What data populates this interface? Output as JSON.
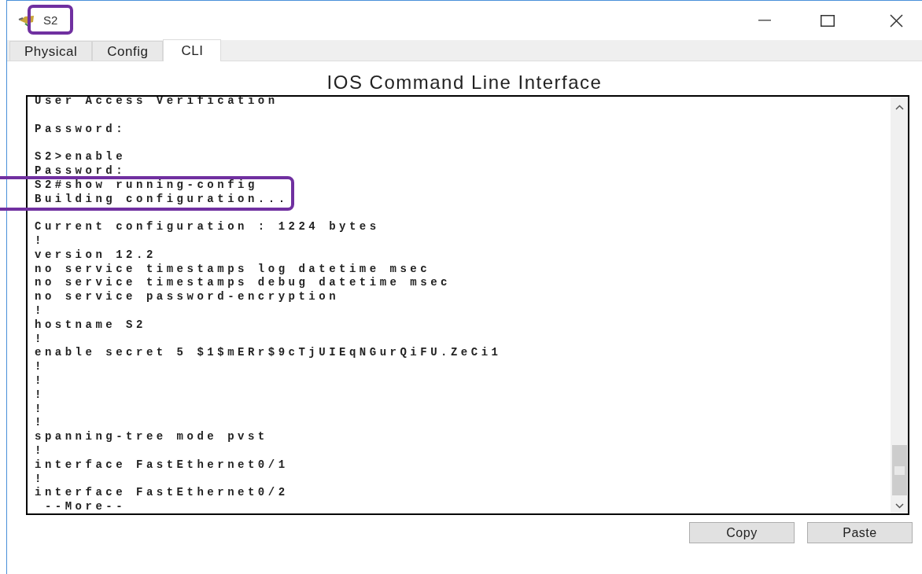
{
  "window": {
    "title": "S2"
  },
  "tabs": [
    {
      "label": "Physical",
      "selected": false
    },
    {
      "label": "Config",
      "selected": false
    },
    {
      "label": "CLI",
      "selected": true
    }
  ],
  "heading": "IOS Command Line Interface",
  "terminal": {
    "lines": [
      {
        "kind": "text",
        "text": "User Access Verification"
      },
      {
        "kind": "blank"
      },
      {
        "kind": "text",
        "text": "Password:"
      },
      {
        "kind": "blank"
      },
      {
        "kind": "text",
        "text": "S2>enable"
      },
      {
        "kind": "text",
        "text": "Password:"
      },
      {
        "kind": "text",
        "text": "S2#show running-config"
      },
      {
        "kind": "text",
        "text": "Building configuration..."
      },
      {
        "kind": "blank"
      },
      {
        "kind": "text",
        "text": "Current configuration : 1224 bytes"
      },
      {
        "kind": "text",
        "text": "!"
      },
      {
        "kind": "text",
        "text": "version 12.2"
      },
      {
        "kind": "text",
        "text": "no service timestamps log datetime msec"
      },
      {
        "kind": "text",
        "text": "no service timestamps debug datetime msec"
      },
      {
        "kind": "text",
        "text": "no service password-encryption"
      },
      {
        "kind": "text",
        "text": "!"
      },
      {
        "kind": "text",
        "text": "hostname S2"
      },
      {
        "kind": "text",
        "text": "!"
      },
      {
        "kind": "text",
        "text": "enable secret 5 $1$mERr$9cTjUIEqNGurQiFU.ZeCi1"
      },
      {
        "kind": "text",
        "text": "!"
      },
      {
        "kind": "text",
        "text": "!"
      },
      {
        "kind": "text",
        "text": "!"
      },
      {
        "kind": "text",
        "text": "!"
      },
      {
        "kind": "text",
        "text": "!"
      },
      {
        "kind": "text",
        "text": "spanning-tree mode pvst"
      },
      {
        "kind": "text",
        "text": "!"
      },
      {
        "kind": "text",
        "text": "interface FastEthernet0/1"
      },
      {
        "kind": "text",
        "text": "!"
      },
      {
        "kind": "text",
        "text": "interface FastEthernet0/2"
      },
      {
        "kind": "text",
        "text": " --More--"
      }
    ]
  },
  "buttons": [
    "Copy",
    "Paste"
  ]
}
